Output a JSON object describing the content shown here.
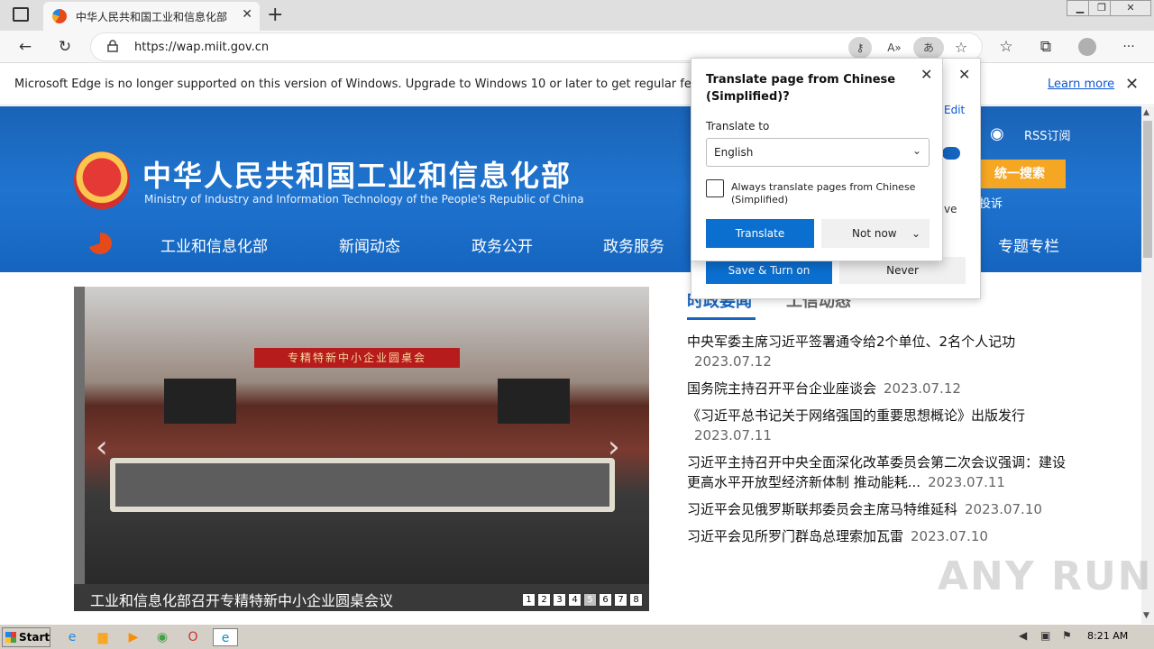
{
  "browser": {
    "tab_title": "中华人民共和国工业和信息化部",
    "tab_close": "✕",
    "new_tab": "+",
    "url": "https://wap.miit.gov.cn",
    "win_min": "▁",
    "win_restore": "❐",
    "win_close": "✕",
    "back": "←",
    "reload": "↻",
    "read_aloud": "A»",
    "translate_btn": "あ",
    "favorites_add": "☆",
    "favorites": "☆",
    "collections": "⧉",
    "more": "···"
  },
  "infobar": {
    "message": "Microsoft Edge is no longer supported on this version of Windows. Upgrade to Windows 10 or later to get regular feature and",
    "learn_more": "Learn more",
    "close": "✕"
  },
  "site": {
    "title_cn": "中华人民共和国工业和信息化部",
    "title_en": "Ministry of Industry and Information Technology of the People's Republic of China",
    "rss": "RSS订阅",
    "search_button": "统一搜索",
    "complaint": "投诉",
    "nav": [
      "工业和信息化部",
      "新闻动态",
      "政务公开",
      "政务服务",
      "专题专栏"
    ]
  },
  "slideshow": {
    "banner": "专精特新中小企业圆桌会",
    "caption": "工业和信息化部召开专精特新中小企业圆桌会议",
    "pages": [
      "1",
      "2",
      "3",
      "4",
      "5",
      "6",
      "7",
      "8"
    ],
    "active_page": 5,
    "prev": "‹",
    "next": "›"
  },
  "news": {
    "tabs": [
      "时政要闻",
      "工信动态"
    ],
    "items": [
      {
        "title": "中央军委主席习近平签署通令给2个单位、2名个人记功",
        "date": "2023.07.12"
      },
      {
        "title": "国务院主持召开平台企业座谈会",
        "date": "2023.07.12"
      },
      {
        "title": "《习近平总书记关于网络强国的重要思想概论》出版发行",
        "date": "2023.07.11"
      },
      {
        "title": "习近平主持召开中央全面深化改革委员会第二次会议强调：建设更高水平开放型经济新体制 推动能耗...",
        "date": "2023.07.11"
      },
      {
        "title": "习近平会见俄罗斯联邦委员会主席马特维延科",
        "date": "2023.07.10"
      },
      {
        "title": "习近平会见所罗门群岛总理索加瓦雷",
        "date": "2023.07.10"
      }
    ]
  },
  "translate_bg": {
    "edit": "Edit",
    "ve": "ve",
    "save": "Save & Turn on",
    "never": "Never",
    "close": "✕"
  },
  "translate": {
    "heading": "Translate page from Chinese (Simplified)?",
    "translate_to_label": "Translate to",
    "language": "English",
    "always_label": "Always translate pages from Chinese (Simplified)",
    "translate_button": "Translate",
    "not_now": "Not now",
    "close": "✕",
    "chevron": "⌄"
  },
  "watermark": "ANY RUN",
  "taskbar": {
    "start": "Start",
    "clock": "8:21 AM"
  }
}
